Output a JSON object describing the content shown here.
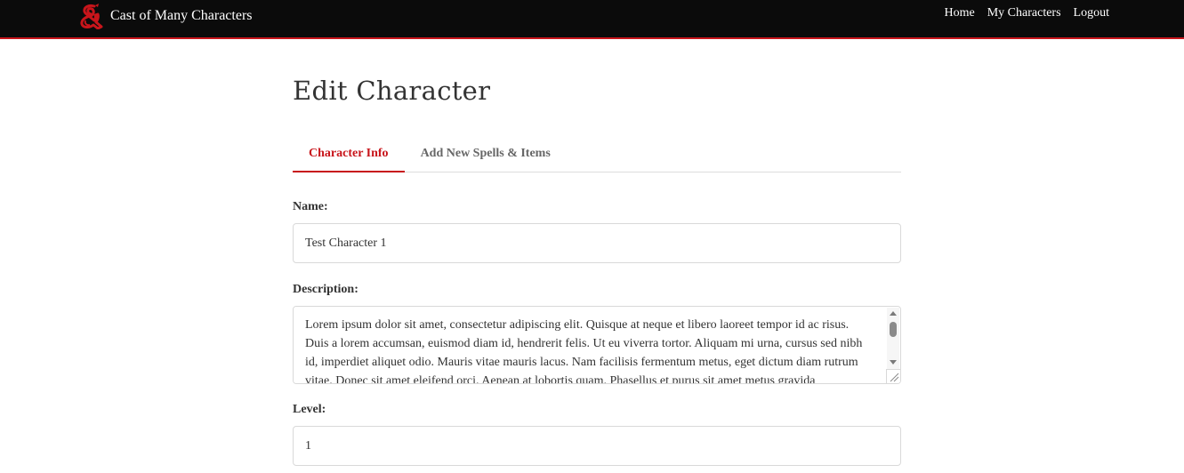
{
  "navbar": {
    "brand_text": "Cast of Many Characters",
    "logo_icon": "ampersand-dragon-icon",
    "accent_color": "#c8151b",
    "links": [
      "Home",
      "My Characters",
      "Logout"
    ]
  },
  "page": {
    "title": "Edit Character"
  },
  "tabs": [
    {
      "label": "Character Info",
      "active": true
    },
    {
      "label": "Add New Spells & Items",
      "active": false
    }
  ],
  "form": {
    "name_label": "Name:",
    "name_value": "Test Character 1",
    "description_label": "Description:",
    "description_value": "Lorem ipsum dolor sit amet, consectetur adipiscing elit. Quisque at neque et libero laoreet tempor id ac risus. Duis a lorem accumsan, euismod diam id, hendrerit felis. Ut eu viverra tortor. Aliquam mi urna, cursus sed nibh id, imperdiet aliquet odio. Mauris vitae mauris lacus. Nam facilisis fermentum metus, eget dictum diam rutrum vitae. Donec sit amet eleifend orci. Aenean at lobortis quam. Phasellus et purus sit amet metus gravida",
    "level_label": "Level:",
    "level_value": "1"
  }
}
